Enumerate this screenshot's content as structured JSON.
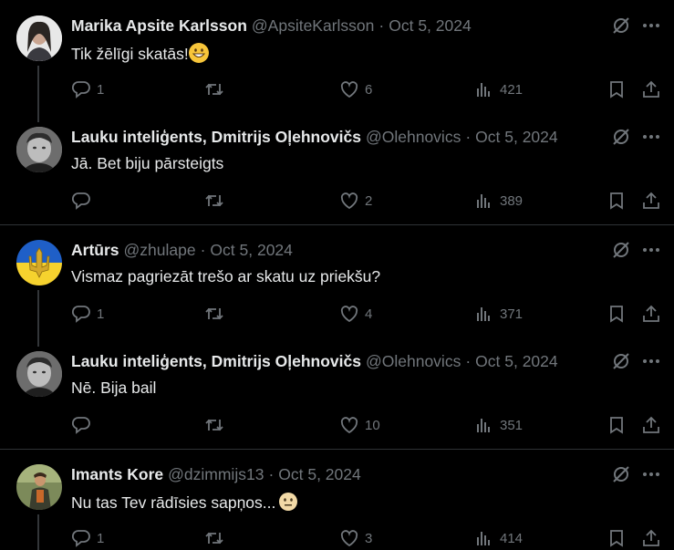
{
  "tweets": [
    {
      "name": "Marika Apsite Karlsson",
      "handle": "@ApsiteKarlsson",
      "date": "Oct 5, 2024",
      "text": "Tik žēlīgi skatās!",
      "emoji": "grinning-face",
      "replies": "1",
      "retweets": "",
      "likes": "6",
      "views": "421"
    },
    {
      "name": "Lauku inteliģents, Dmitrijs Oļehnovičs",
      "handle": "@Olehnovics",
      "date": "Oct 5, 2024",
      "text": "Jā. Bet biju pārsteigts",
      "emoji": "",
      "replies": "",
      "retweets": "",
      "likes": "2",
      "views": "389"
    },
    {
      "name": "Artūrs",
      "handle": "@zhulape",
      "date": "Oct 5, 2024",
      "text": "Vismaz pagriezāt trešo ar skatu uz priekšu?",
      "emoji": "",
      "replies": "1",
      "retweets": "",
      "likes": "4",
      "views": "371"
    },
    {
      "name": "Lauku inteliģents, Dmitrijs Oļehnovičs",
      "handle": "@Olehnovics",
      "date": "Oct 5, 2024",
      "text": "Nē. Bija bail",
      "emoji": "",
      "replies": "",
      "retweets": "",
      "likes": "10",
      "views": "351"
    },
    {
      "name": "Imants Kore",
      "handle": "@dzimmijs13",
      "date": "Oct 5, 2024",
      "text": "Nu tas Tev rādīsies sapņos...",
      "emoji": "neutral-face",
      "replies": "1",
      "retweets": "",
      "likes": "3",
      "views": "414"
    }
  ],
  "separator": "·",
  "icons": {
    "grok": "grok-icon",
    "more": "more-icon",
    "reply": "reply-icon",
    "retweet": "retweet-icon",
    "like": "like-icon",
    "views": "views-icon",
    "bookmark": "bookmark-icon",
    "share": "share-icon"
  },
  "colors": {
    "background": "#000000",
    "text": "#e7e9ea",
    "muted": "#71767b",
    "divider": "#2f3336"
  }
}
